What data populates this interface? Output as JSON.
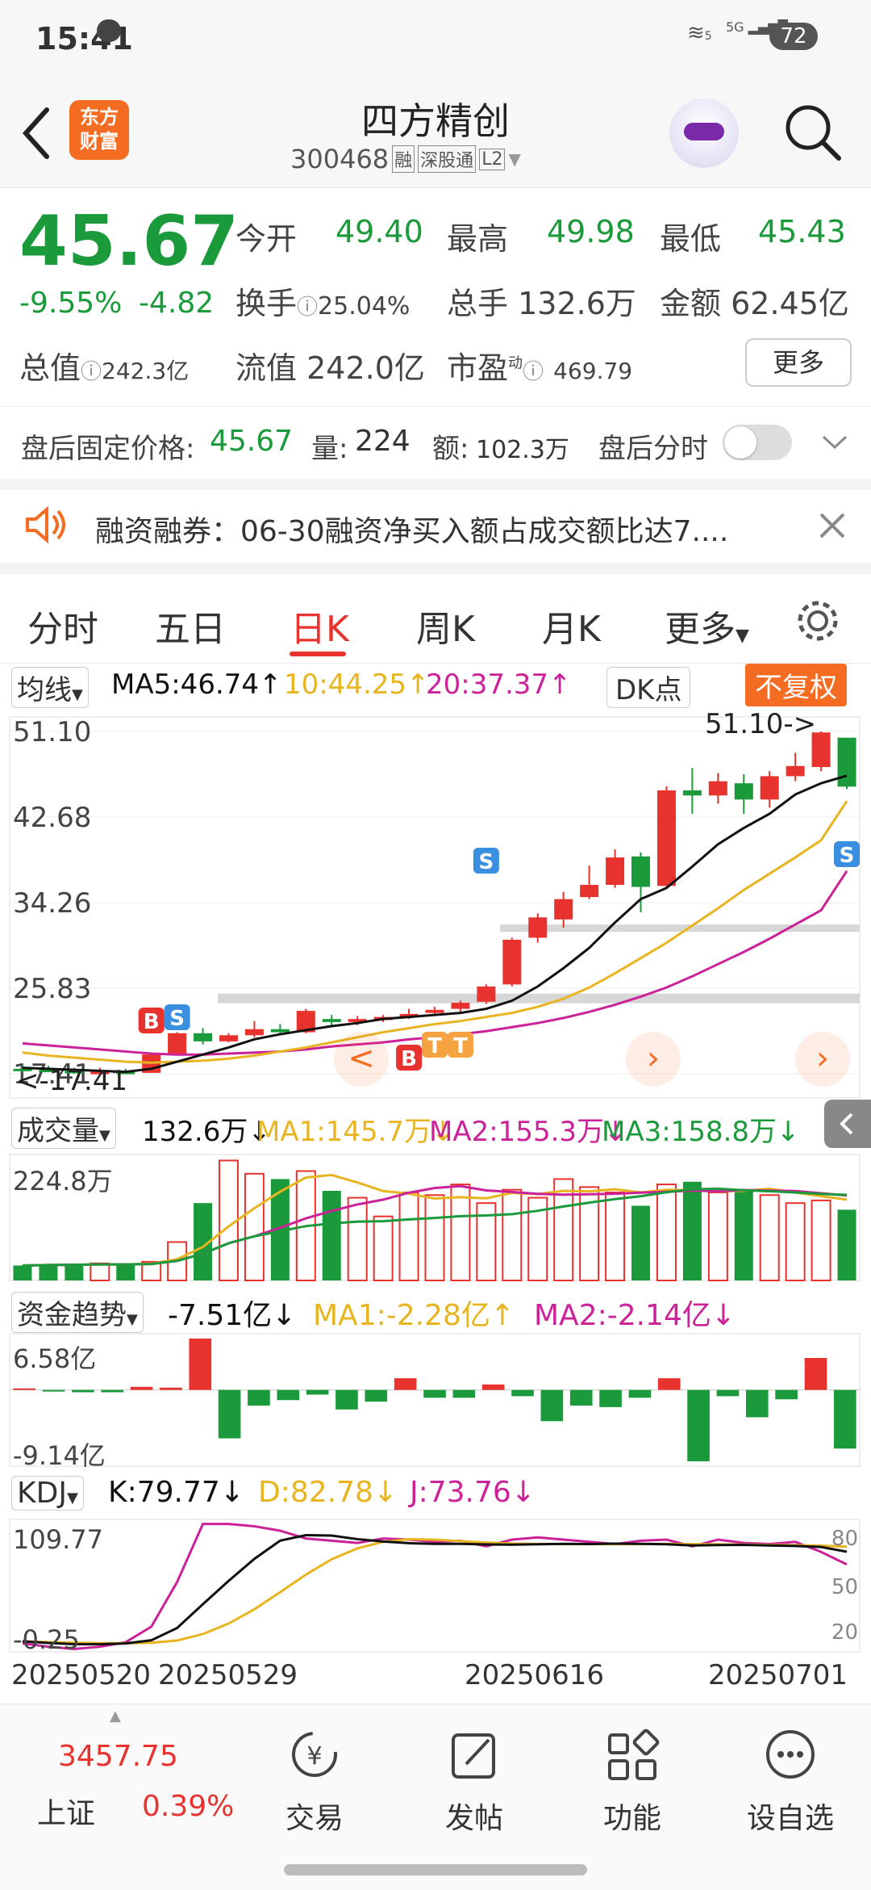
{
  "status": {
    "time": "15:41",
    "battery": "72",
    "net1": "5",
    "net2": "5G"
  },
  "header": {
    "title": "四方精创",
    "code": "300468",
    "tags": [
      "融",
      "深股通",
      "L2"
    ],
    "logo": "东方\n财富"
  },
  "quote": {
    "price": "45.67",
    "change_pct": "-9.55%",
    "change": "-4.82",
    "open_label": "今开",
    "open": "49.40",
    "high_label": "最高",
    "high": "49.98",
    "low_label": "最低",
    "low": "45.43",
    "turnover_label": "换手",
    "turnover": "25.04%",
    "vol_label": "总手",
    "vol": "132.6万",
    "amt_label": "金额",
    "amt": "62.45亿",
    "mcap_label": "总值",
    "mcap": "242.3亿",
    "float_label": "流值",
    "float": "242.0亿",
    "pe_label": "市盈",
    "pe_sup": "动",
    "pe": "469.79",
    "more": "更多"
  },
  "after_hours": {
    "price_label": "盘后固定价格:",
    "price": "45.67",
    "vol_label": "量:",
    "vol": "224",
    "amt_label": "额:",
    "amt": "102.3万",
    "switch_label": "盘后分时"
  },
  "notice": {
    "text": "融资融券：06-30融资净买入额占成交额比达7...."
  },
  "tabs": [
    "分时",
    "五日",
    "日K",
    "周K",
    "月K",
    "更多"
  ],
  "indicators": {
    "ma_label": "均线",
    "ma5": "MA5:46.74↑",
    "ma10": "10:44.25↑",
    "ma20": "20:37.37↑",
    "dk": "DK点",
    "fq": "不复权",
    "vol_label": "成交量",
    "vol_val": "132.6万↓",
    "vma1": "MA1:145.7万↓",
    "vma2": "MA2:155.3万↓",
    "vma3": "MA3:158.8万↓",
    "fund_label": "资金趋势",
    "fund_val": "-7.51亿↓",
    "fma1": "MA1:-2.28亿↑",
    "fma2": "MA2:-2.14亿↓",
    "kdj_label": "KDJ",
    "k": "K:79.77↓",
    "d": "D:82.78↓",
    "j": "J:73.76↓"
  },
  "colors": {
    "up": "#e8322e",
    "down": "#1a9a3a",
    "ma5": "#111111",
    "ma10": "#e8b420",
    "ma20": "#cc2299",
    "accent": "#f36c21"
  },
  "chart_data": [
    {
      "type": "candlestick",
      "title": "",
      "dates_shown": [
        "20250520",
        "20250529",
        "20250616",
        "20250701"
      ],
      "y_ticks": [
        "51.10",
        "42.68",
        "34.26",
        "25.83",
        "17.41"
      ],
      "ylim": [
        17.41,
        51.1
      ],
      "annotations": [
        "51.10->",
        "<-17.41"
      ],
      "ohlc": [
        [
          17.9,
          18.3,
          17.5,
          17.8
        ],
        [
          17.8,
          18.2,
          17.6,
          17.7
        ],
        [
          17.7,
          18.0,
          17.4,
          17.6
        ],
        [
          17.6,
          18.0,
          17.4,
          17.6
        ],
        [
          17.6,
          17.9,
          17.41,
          17.5
        ],
        [
          17.5,
          19.4,
          17.5,
          19.3
        ],
        [
          19.3,
          21.5,
          19.2,
          21.4
        ],
        [
          21.4,
          21.9,
          20.3,
          20.6
        ],
        [
          20.6,
          21.4,
          20.5,
          21.2
        ],
        [
          21.2,
          22.6,
          21.0,
          21.8
        ],
        [
          21.8,
          22.3,
          21.3,
          21.5
        ],
        [
          21.5,
          23.8,
          21.4,
          23.6
        ],
        [
          22.8,
          23.2,
          22.2,
          22.5
        ],
        [
          22.5,
          23.1,
          22.2,
          22.8
        ],
        [
          22.7,
          23.2,
          22.5,
          23.0
        ],
        [
          23.0,
          23.8,
          22.8,
          23.3
        ],
        [
          23.4,
          24.0,
          23.1,
          23.7
        ],
        [
          23.8,
          24.6,
          23.5,
          24.4
        ],
        [
          24.5,
          26.2,
          24.3,
          26.0
        ],
        [
          26.2,
          30.8,
          26.0,
          30.6
        ],
        [
          30.8,
          33.2,
          30.3,
          32.8
        ],
        [
          32.6,
          35.3,
          31.8,
          34.6
        ],
        [
          34.8,
          37.9,
          34.6,
          36.0
        ],
        [
          36.0,
          39.5,
          35.7,
          38.7
        ],
        [
          38.8,
          39.2,
          33.3,
          35.8
        ],
        [
          35.9,
          45.7,
          35.7,
          45.3
        ],
        [
          45.3,
          47.5,
          43.0,
          44.8
        ],
        [
          44.8,
          47.0,
          44.0,
          46.2
        ],
        [
          46.0,
          46.9,
          43.0,
          44.4
        ],
        [
          44.4,
          47.2,
          43.6,
          46.7
        ],
        [
          46.7,
          49.0,
          46.2,
          47.7
        ],
        [
          47.6,
          51.1,
          47.2,
          51.0
        ],
        [
          50.49,
          49.98,
          45.43,
          45.67
        ]
      ],
      "ma5": [
        18.0,
        17.9,
        17.8,
        17.7,
        17.6,
        17.9,
        18.6,
        19.3,
        20.0,
        20.8,
        21.3,
        21.7,
        22.1,
        22.4,
        22.8,
        23.0,
        23.2,
        23.4,
        23.8,
        24.6,
        26.0,
        27.8,
        29.8,
        32.3,
        34.6,
        35.7,
        37.8,
        40.0,
        41.6,
        43.0,
        44.9,
        46.0,
        46.74
      ],
      "ma10": [
        19.5,
        19.2,
        19.0,
        18.8,
        18.6,
        18.5,
        18.6,
        18.7,
        18.9,
        19.2,
        19.6,
        20.0,
        20.5,
        21.0,
        21.5,
        21.9,
        22.3,
        22.6,
        23.0,
        23.4,
        24.0,
        24.8,
        25.9,
        27.3,
        28.8,
        30.3,
        32.0,
        33.7,
        35.5,
        37.1,
        38.7,
        40.4,
        44.25
      ],
      "ma20": [
        20.4,
        20.2,
        20.0,
        19.8,
        19.6,
        19.4,
        19.3,
        19.3,
        19.4,
        19.5,
        19.6,
        19.8,
        20.1,
        20.3,
        20.5,
        20.8,
        21.0,
        21.3,
        21.6,
        22.0,
        22.4,
        22.9,
        23.5,
        24.2,
        25.0,
        25.9,
        27.0,
        28.2,
        29.4,
        30.7,
        32.1,
        33.5,
        37.37
      ],
      "signals": {
        "B": [
          5,
          15,
          32
        ],
        "S": [
          6,
          18,
          32
        ],
        "T": [
          16,
          17
        ]
      }
    },
    {
      "type": "bar",
      "title": "成交量",
      "y_ticks": [
        "224.8万"
      ],
      "values": [
        28,
        30,
        30,
        32,
        30,
        35,
        72,
        145,
        224.8,
        200,
        190,
        205,
        168,
        155,
        120,
        165,
        160,
        180,
        145,
        170,
        155,
        190,
        175,
        165,
        140,
        180,
        185,
        165,
        170,
        160,
        145,
        150,
        132.6
      ]
    },
    {
      "type": "bar",
      "title": "资金趋势",
      "y_ticks": [
        "6.58亿",
        "-9.14亿"
      ],
      "values": [
        0.2,
        -0.2,
        -0.3,
        -0.3,
        0.4,
        0.3,
        6.58,
        -6.2,
        -2.0,
        -1.3,
        -0.6,
        -2.5,
        -1.5,
        1.5,
        -1.0,
        -1.0,
        0.7,
        -0.8,
        -4.0,
        -2.0,
        -2.2,
        -1.0,
        1.5,
        -9.14,
        -0.8,
        -3.5,
        -1.2,
        4.1,
        -7.51
      ]
    },
    {
      "type": "line",
      "title": "KDJ",
      "y_ticks": [
        "109.77",
        "-0.25"
      ],
      "right_ticks": [
        "80",
        "50",
        "20"
      ]
    }
  ],
  "bottom": {
    "index_value": "3457.75",
    "index_name": "上证",
    "index_pct": "0.39%",
    "nav": [
      "交易",
      "发帖",
      "功能",
      "设自选"
    ]
  }
}
